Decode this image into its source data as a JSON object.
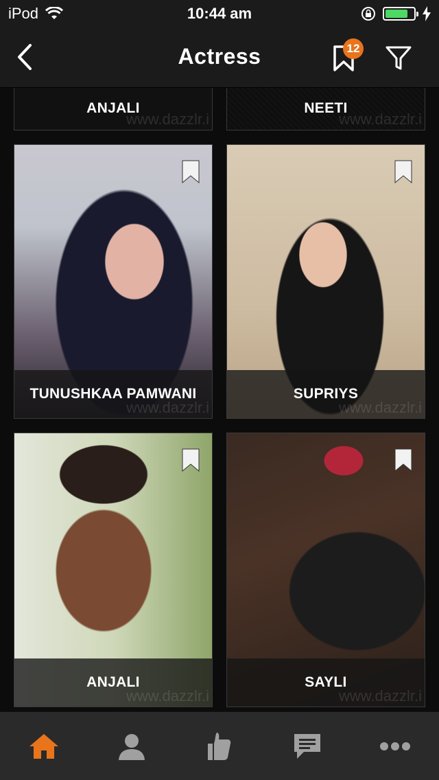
{
  "status_bar": {
    "carrier": "iPod",
    "time": "10:44 am",
    "battery_color": "#4cd964"
  },
  "header": {
    "title": "Actress",
    "back_icon": "chevron-left-icon",
    "bookmark_badge": "12",
    "filter_icon": "filter-icon",
    "accent_color": "#e8741c"
  },
  "grid": {
    "watermark": "www.dazzlr.i",
    "cards": [
      {
        "name": "ANJALI"
      },
      {
        "name": "NEETI"
      },
      {
        "name": "TUNUSHKAA PAMWANI"
      },
      {
        "name": "SUPRIYS"
      },
      {
        "name": "ANJALI"
      },
      {
        "name": "SAYLI"
      }
    ]
  },
  "tab_bar": {
    "tabs": [
      {
        "icon": "home-icon",
        "active": true
      },
      {
        "icon": "profile-icon",
        "active": false
      },
      {
        "icon": "thumbs-up-icon",
        "active": false
      },
      {
        "icon": "chat-icon",
        "active": false
      },
      {
        "icon": "more-icon",
        "active": false
      }
    ],
    "active_color": "#e8741c",
    "inactive_color": "#a0a0a0"
  }
}
